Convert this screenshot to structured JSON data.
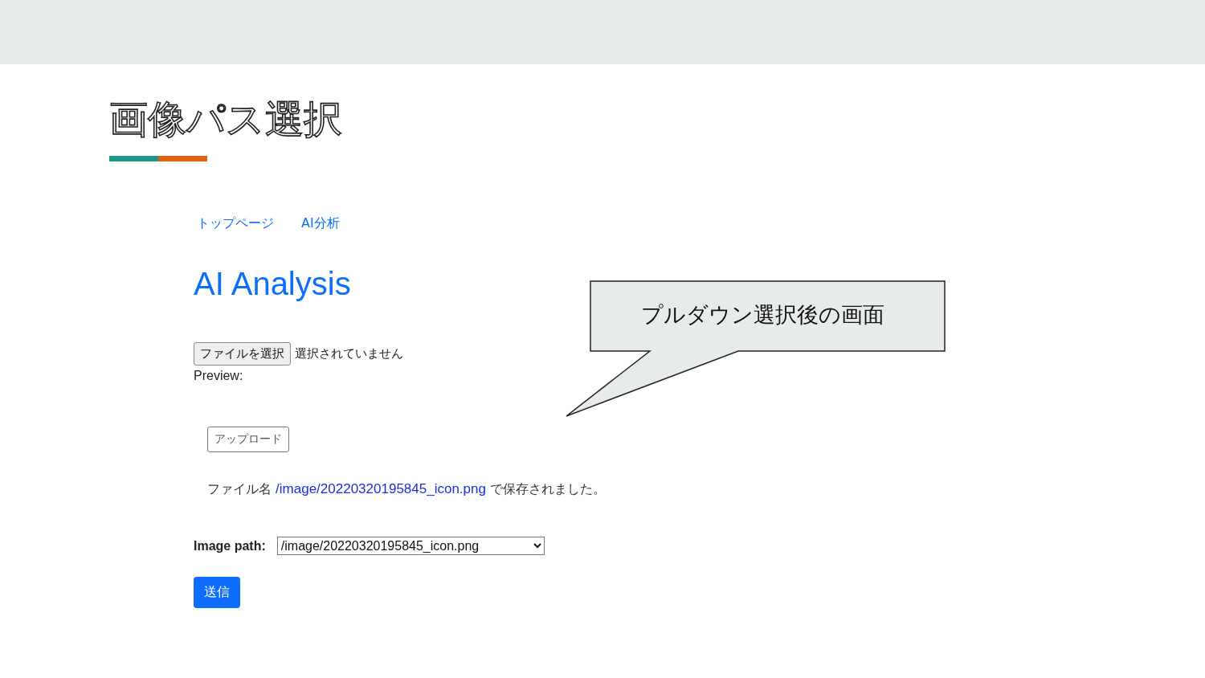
{
  "slide_title": "画像パス選択",
  "callout": {
    "text": "プルダウン選択後の画面"
  },
  "nav": [
    {
      "label": "トップページ"
    },
    {
      "label": "AI分析"
    }
  ],
  "heading": "AI Analysis",
  "file_input": {
    "button": "ファイルを選択",
    "status": "選択されていません"
  },
  "preview_label": "Preview:",
  "upload_button": "アップロード",
  "saved_message": {
    "prefix": "ファイル名",
    "link": "/image/20220320195845_icon.png",
    "suffix": "で保存されました。"
  },
  "image_path": {
    "label": "Image path:",
    "value": "/image/20220320195845_icon.png"
  },
  "submit_button": "送信"
}
